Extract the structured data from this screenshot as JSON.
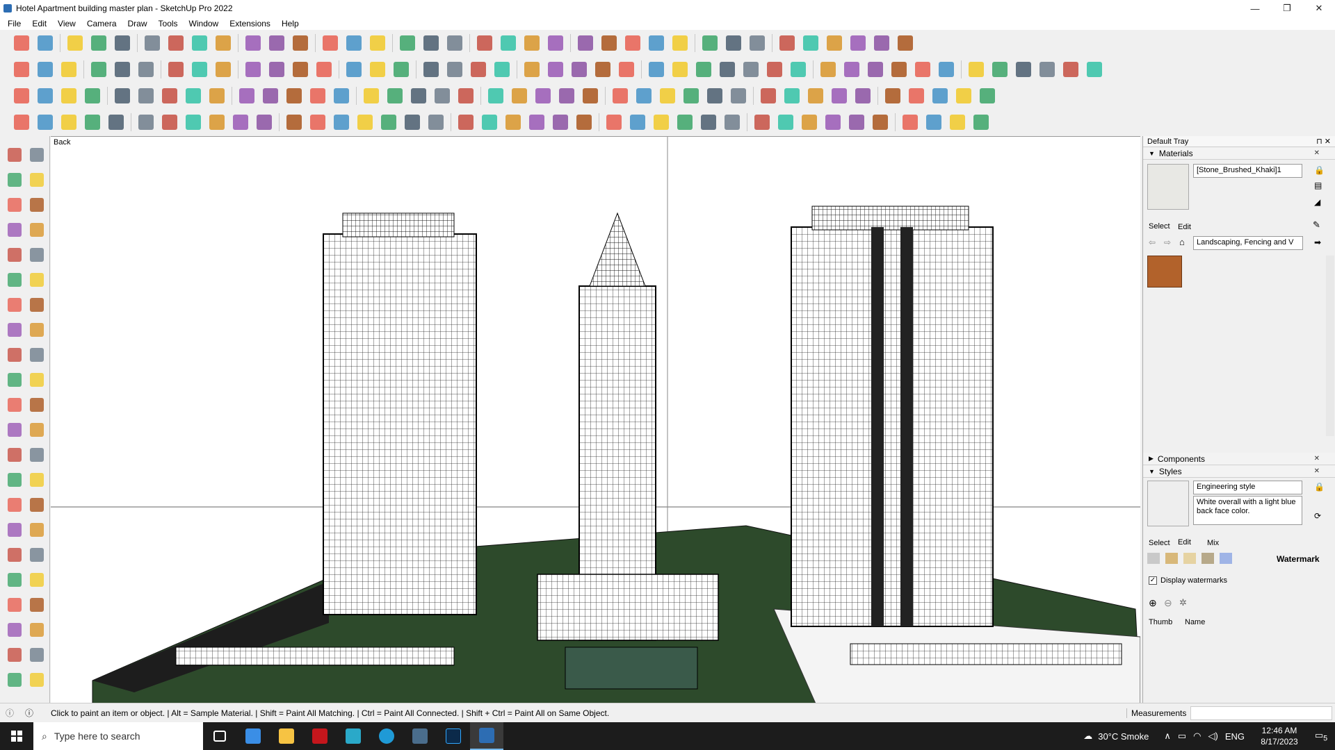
{
  "window": {
    "title": "Hotel Apartment building master plan - SketchUp Pro 2022",
    "minimize": "—",
    "restore": "❐",
    "close": "✕"
  },
  "menu": [
    "File",
    "Edit",
    "View",
    "Camera",
    "Draw",
    "Tools",
    "Window",
    "Extensions",
    "Help"
  ],
  "viewport": {
    "scene_label": "Back"
  },
  "tray": {
    "title": "Default Tray",
    "materials": {
      "header": "Materials",
      "material_name": "[Stone_Brushed_Khaki]1",
      "tab_select": "Select",
      "tab_edit": "Edit",
      "library": "Landscaping, Fencing and V"
    },
    "components": {
      "header": "Components"
    },
    "styles": {
      "header": "Styles",
      "style_name": "Engineering style",
      "style_desc": "White overall with a light blue back face color.",
      "tab_select": "Select",
      "tab_edit": "Edit",
      "tab_mix": "Mix",
      "watermark_label": "Watermark",
      "display_watermarks": "Display watermarks",
      "col_thumb": "Thumb",
      "col_name": "Name"
    }
  },
  "status": {
    "hint": "Click to paint an item or object. | Alt = Sample Material. | Shift = Paint All Matching. | Ctrl = Paint All Connected. | Shift + Ctrl = Paint All on Same Object.",
    "measurements_label": "Measurements"
  },
  "taskbar": {
    "search_placeholder": "Type here to search",
    "weather": "30°C  Smoke",
    "lang": "ENG",
    "time": "12:46 AM",
    "date": "8/17/2023",
    "notif_count": "5"
  }
}
